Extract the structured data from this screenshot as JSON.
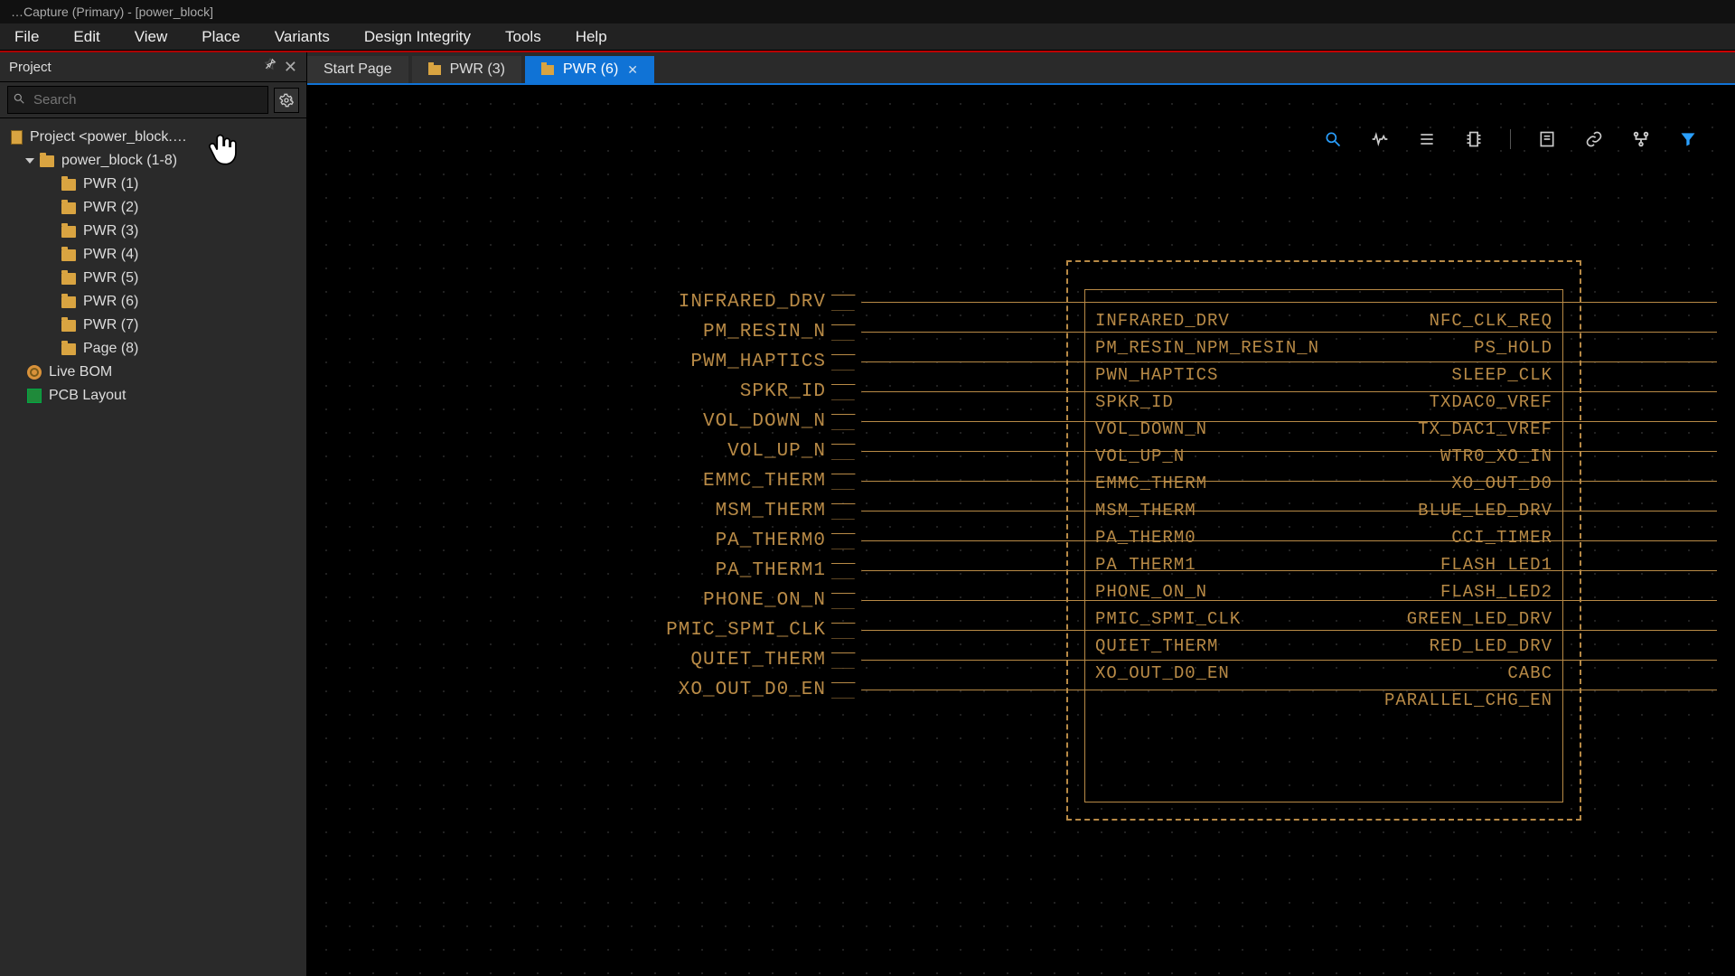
{
  "window": {
    "title": "…Capture (Primary) - [power_block]"
  },
  "menu": {
    "items": [
      "File",
      "Edit",
      "View",
      "Place",
      "Variants",
      "Design Integrity",
      "Tools",
      "Help"
    ]
  },
  "sidebar": {
    "panel_title": "Project",
    "search_placeholder": "Search",
    "root_label": "Project <power_block.…",
    "design_label": "power_block (1-8)",
    "pages": [
      "PWR (1)",
      "PWR (2)",
      "PWR (3)",
      "PWR (4)",
      "PWR (5)",
      "PWR (6)",
      "PWR (7)",
      "Page (8)"
    ],
    "live_bom": "Live BOM",
    "pcb_layout": "PCB Layout"
  },
  "tabs": {
    "items": [
      {
        "label": "Start Page",
        "has_icon": false,
        "closable": false,
        "active": false
      },
      {
        "label": "PWR (3)",
        "has_icon": true,
        "closable": false,
        "active": false
      },
      {
        "label": "PWR (6)",
        "has_icon": true,
        "closable": true,
        "active": true
      }
    ]
  },
  "schematic": {
    "input_nets": [
      "INFRARED_DRV",
      "PM_RESIN_N",
      "PWM_HAPTICS",
      "SPKR_ID",
      "VOL_DOWN_N",
      "VOL_UP_N",
      "EMMC_THERM",
      "MSM_THERM",
      "PA_THERM0",
      "PA_THERM1",
      "PHONE_ON_N",
      "PMIC_SPMI_CLK",
      "QUIET_THERM",
      "XO_OUT_D0_EN"
    ],
    "block_left_pins": [
      "INFRARED_DRV",
      "PM_RESIN_NPM_RESIN_N",
      "PWN_HAPTICS",
      "SPKR_ID",
      "VOL_DOWN_N",
      "VOL_UP_N",
      "EMMC_THERM",
      "MSM_THERM",
      "PA_THERM0",
      "PA_THERM1",
      "PHONE_ON_N",
      "PMIC_SPMI_CLK",
      "QUIET_THERM",
      "XO_OUT_D0_EN"
    ],
    "block_right_pins": [
      "NFC_CLK_REQ",
      "PS_HOLD",
      "SLEEP_CLK",
      "TXDAC0_VREF",
      "TX_DAC1_VREF",
      "WTR0_XO_IN",
      "XO_OUT_D0",
      "",
      "BLUE_LED_DRV",
      "CCI_TIMER",
      "FLASH_LED1",
      "FLASH_LED2",
      "GREEN_LED_DRV",
      "RED_LED_DRV",
      "CABC",
      "PARALLEL_CHG_EN"
    ]
  },
  "toolbar_icons": [
    "search-icon",
    "waveform-icon",
    "list-icon",
    "component-icon",
    "sheet-icon",
    "link-icon",
    "place-icon",
    "filter-icon"
  ]
}
